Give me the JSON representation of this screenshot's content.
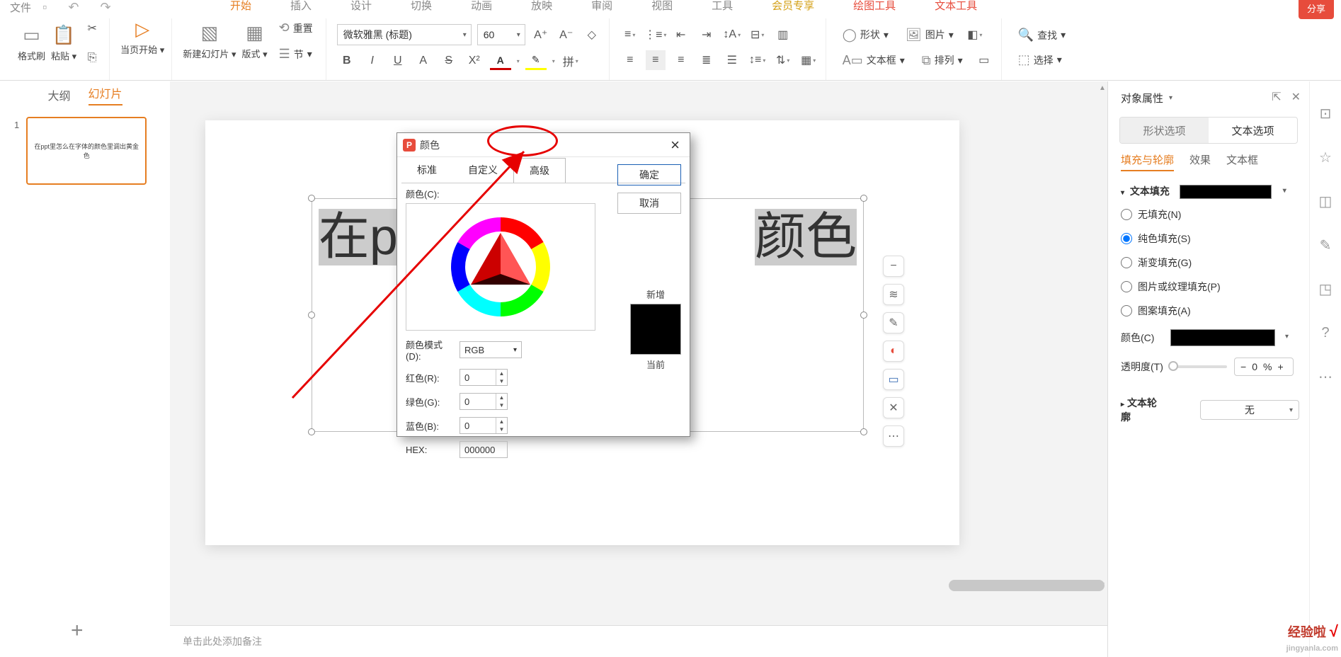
{
  "qat": {
    "file": "文件",
    "save_icon": "□",
    "undo_icon": "↶",
    "redo_icon": "↷"
  },
  "menu": {
    "start": "开始",
    "insert": "插入",
    "design": "设计",
    "transition": "切换",
    "animation": "动画",
    "slideshow": "放映",
    "review": "审阅",
    "view": "视图",
    "tools": "工具",
    "vip": "会员专享",
    "drawing": "绘图工具",
    "text_tools": "文本工具",
    "share": "分享"
  },
  "ribbon": {
    "format_painter": "格式刷",
    "paste": "粘贴",
    "cut_icon": "✂",
    "from_current": "当页开始",
    "new_slide": "新建幻灯片",
    "layout": "版式",
    "reset": "重置",
    "section": "节",
    "font_name": "微软雅黑 (标题)",
    "font_size": "60",
    "bold": "B",
    "italic": "I",
    "underline": "U",
    "strike": "S",
    "shape": "形状",
    "image": "图片",
    "textbox": "文本框",
    "arrange": "排列",
    "find": "查找",
    "select": "选择"
  },
  "left": {
    "outline": "大纲",
    "slides": "幻灯片",
    "num": "1",
    "thumb_text": "在ppt里怎么在字体的颜色里调出黄金色"
  },
  "slide_text": {
    "line": "在ppt里怎…       …颜色",
    "obscured_part": "里…"
  },
  "dialog": {
    "title": "颜色",
    "tab_standard": "标准",
    "tab_custom": "自定义",
    "tab_advanced": "高级",
    "ok": "确定",
    "cancel": "取消",
    "color_c": "颜色(C):",
    "mode": "颜色模式(D):",
    "mode_val": "RGB",
    "r": "红色(R):",
    "g": "绿色(G):",
    "b": "蓝色(B):",
    "rv": "0",
    "gv": "0",
    "bv": "0",
    "hex": "HEX:",
    "hex_val": "000000",
    "new": "新增",
    "current": "当前"
  },
  "prop": {
    "header": "对象属性",
    "shape_opts": "形状选项",
    "text_opts": "文本选项",
    "tab_fill": "填充与轮廓",
    "tab_effect": "效果",
    "tab_textbox": "文本框",
    "sec_text_fill": "文本填充",
    "no_fill": "无填充(N)",
    "solid_fill": "纯色填充(S)",
    "gradient_fill": "渐变填充(G)",
    "picture_fill": "图片或纹理填充(P)",
    "pattern_fill": "图案填充(A)",
    "color_label": "颜色(C)",
    "transparency": "透明度(T)",
    "transparency_val": "0",
    "pct": "%",
    "sec_outline": "文本轮廓",
    "outline_none": "无"
  },
  "notes": {
    "placeholder": "单击此处添加备注"
  },
  "far_right": {
    "settings": "⚙",
    "star": "☆",
    "book": "◫",
    "wrench": "✎",
    "cube": "◳",
    "help": "?",
    "more": "⋯"
  },
  "watermark": {
    "text": "经验啦",
    "url": "jingyanla.com"
  }
}
